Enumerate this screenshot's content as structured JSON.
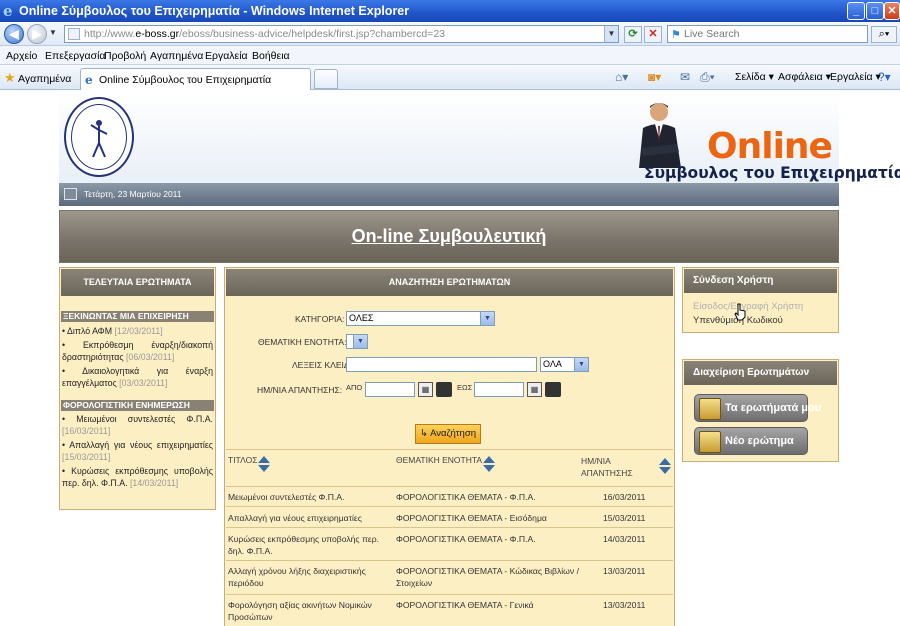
{
  "browser": {
    "title": "Online Σύμβουλος του Επιχειρηματία - Windows Internet Explorer",
    "url_prefix": "http://www.",
    "url_domain": "e-boss.gr",
    "url_path": "/eboss/business-advice/helpdesk/first.jsp?chambercd=23",
    "search_placeholder": "Live Search",
    "menu": [
      "Αρχείο",
      "Επεξεργασία",
      "Προβολή",
      "Αγαπημένα",
      "Εργαλεία",
      "Βοήθεια"
    ],
    "favorites_label": "Αγαπημένα",
    "tab_label": "Online Σύμβουλος του Επιχειρηματία",
    "commands": {
      "page": "Σελίδα",
      "safety": "Ασφάλεια",
      "tools": "Εργαλεία"
    }
  },
  "header": {
    "online_word": "Online",
    "advisor_word": "Σύμβουλος του Επιχειρηματία",
    "date": "Τετάρτη, 23 Μαρτίου 2011"
  },
  "banner": {
    "title": "On-line Συμβουλευτική"
  },
  "left": {
    "title": "ΤΕΛΕΥΤΑΙΑ ΕΡΩΤΗΜΑΤΑ",
    "section1": "ΞΕΚΙΝΩΝΤΑΣ ΜΙΑ ΕΠΙΧΕΙΡΗΣΗ",
    "section1_items": [
      {
        "text": "Διπλό ΑΦΜ",
        "date": "[12/03/2011]"
      },
      {
        "text": "Εκπρόθεσμη έναρξη/διακοπή δραστηριότητας",
        "date": "[06/03/2011]"
      },
      {
        "text": "Δικαιολογητικά για έναρξη επαγγέλματος",
        "date": "[03/03/2011]"
      }
    ],
    "section2": "ΦΟΡΟΛΟΓΙΣΤΙΚΗ ΕΝΗΜΕΡΩΣΗ",
    "section2_items": [
      {
        "text": "Μειωμένοι συντελεστές Φ.Π.Α.",
        "date": "[16/03/2011]"
      },
      {
        "text": "Απαλλαγή για νέους επιχειρηματίες",
        "date": "[15/03/2011]"
      },
      {
        "text": "Κυρώσεις εκπρόθεσμης υποβολής περ. δηλ. Φ.Π.Α.",
        "date": "[14/03/2011]"
      }
    ]
  },
  "search": {
    "title": "ΑΝΑΖΗΤΗΣΗ ΕΡΩΤΗΜΑΤΩΝ",
    "category_label": "ΚΑΤΗΓΟΡΙΑ:",
    "category_value": "ΟΛΕΣ",
    "theme_label": "ΘΕΜΑΤΙΚΗ ΕΝΟΤΗΤΑ:",
    "keywords_label": "ΛΕΞΕΙΣ ΚΛΕΙΔΙΑ:",
    "keywords_mode": "ΟΛΑ",
    "date_label": "ΗΜ/ΝΙΑ ΑΠΑΝΤΗΣΗΣ:",
    "from_label": "ΑΠΟ",
    "to_label": "ΕΩΣ",
    "button": "Αναζήτηση"
  },
  "results": {
    "headers": {
      "title": "ΤΙΤΛΟΣ",
      "theme": "ΘΕΜΑΤΙΚΗ ΕΝΟΤΗΤΑ",
      "date": "ΗΜ/ΝΙΑ ΑΠΑΝΤΗΣΗΣ"
    },
    "rows": [
      {
        "title": "Μειωμένοι συντελεστές Φ.Π.Α.",
        "theme": "ΦΟΡΟΛΟΓΙΣΤΙΚΑ ΘΕΜΑΤΑ - Φ.Π.Α.",
        "date": "16/03/2011"
      },
      {
        "title": "Απαλλαγή για νέους επιχειρηματίες",
        "theme": "ΦΟΡΟΛΟΓΙΣΤΙΚΑ ΘΕΜΑΤΑ - Εισόδημα",
        "date": "15/03/2011"
      },
      {
        "title": "Κυρώσεις εκπρόθεσμης υποβολής περ. δηλ. Φ.Π.Α.",
        "theme": "ΦΟΡΟΛΟΓΙΣΤΙΚΑ ΘΕΜΑΤΑ - Φ.Π.Α.",
        "date": "14/03/2011"
      },
      {
        "title": "Αλλαγή χρόνου λήξης διαχειριστικής περιόδου",
        "theme": "ΦΟΡΟΛΟΓΙΣΤΙΚΑ ΘΕΜΑΤΑ - Κώδικας Βιβλίων / Στοιχείων",
        "date": "13/03/2011"
      },
      {
        "title": "Φορολόγηση αξίας ακινήτων Νομικών Προσώπων",
        "theme": "ΦΟΡΟΛΟΓΙΣΤΙΚΑ ΘΕΜΑΤΑ - Γενικά",
        "date": "13/03/2011"
      }
    ]
  },
  "login": {
    "title": "Σύνδεση Χρήστη",
    "signin_link": "Είσοδος/Εγγραφή Χρήστη",
    "reminder_link": "Υπενθύμιση Κωδικού"
  },
  "manage": {
    "title": "Διαχείριση Ερωτημάτων",
    "my_questions": "Τα ερωτήματά μου",
    "new_question": "Νέο ερώτημα"
  },
  "colors": {
    "accent_orange": "#ec6612",
    "panel_bg": "#fcefc4",
    "header_brown": "#7c756b"
  },
  "icons": [
    "ie-logo-icon",
    "back-icon",
    "forward-icon",
    "refresh-icon",
    "stop-icon",
    "search-icon",
    "star-icon",
    "home-icon",
    "calendar-icon",
    "clear-icon",
    "sort-icon",
    "note-icon",
    "pencil-icon",
    "pointer-cursor-icon"
  ]
}
